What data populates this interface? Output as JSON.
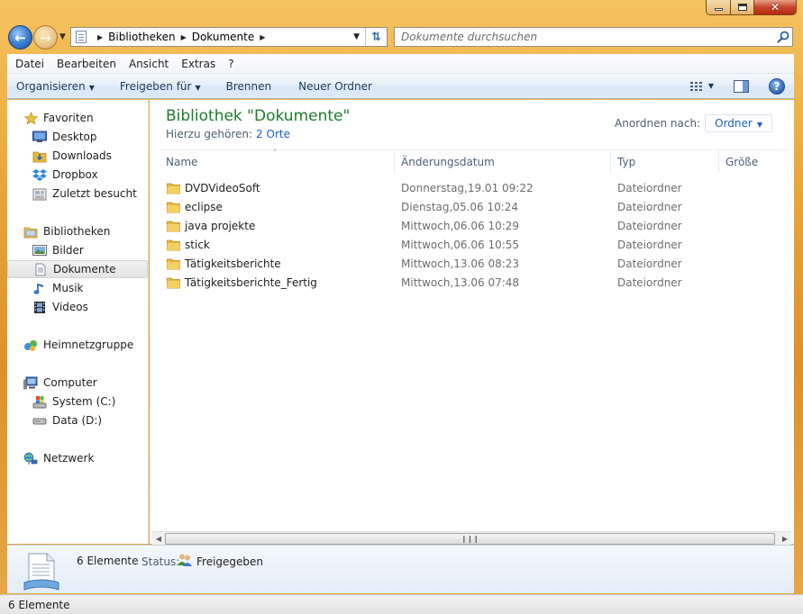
{
  "window": {
    "minimize_label": "",
    "close_glyph": "✕"
  },
  "address_bar": {
    "crumbs": [
      "Bibliotheken",
      "Dokumente"
    ],
    "search_placeholder": "Dokumente durchsuchen"
  },
  "menu": {
    "items": [
      "Datei",
      "Bearbeiten",
      "Ansicht",
      "Extras",
      "?"
    ]
  },
  "commands": {
    "organize": "Organisieren",
    "share": "Freigeben für",
    "burn": "Brennen",
    "new_folder": "Neuer Ordner"
  },
  "nav": {
    "favorites": {
      "label": "Favoriten",
      "items": [
        "Desktop",
        "Downloads",
        "Dropbox",
        "Zuletzt besucht"
      ]
    },
    "libraries": {
      "label": "Bibliotheken",
      "items": [
        "Bilder",
        "Dokumente",
        "Musik",
        "Videos"
      ],
      "selected": "Dokumente"
    },
    "homegroup": {
      "label": "Heimnetzgruppe"
    },
    "computer": {
      "label": "Computer",
      "items": [
        "System (C:)",
        "Data (D:)"
      ]
    },
    "network": {
      "label": "Netzwerk"
    }
  },
  "library": {
    "title": "Bibliothek \"Dokumente\"",
    "includes_label": "Hierzu gehören:",
    "includes_link": "2 Orte",
    "arrange_label": "Anordnen nach:",
    "arrange_value": "Ordner"
  },
  "columns": [
    "Name",
    "Änderungsdatum",
    "Typ",
    "Größe"
  ],
  "files": [
    {
      "name": "DVDVideoSoft",
      "date": "Donnerstag,19.01 09:22",
      "type": "Dateiordner"
    },
    {
      "name": "eclipse",
      "date": "Dienstag,05.06 10:24",
      "type": "Dateiordner"
    },
    {
      "name": "java projekte",
      "date": "Mittwoch,06.06 10:29",
      "type": "Dateiordner"
    },
    {
      "name": "stick",
      "date": "Mittwoch,06.06 10:55",
      "type": "Dateiordner"
    },
    {
      "name": "Tätigkeitsberichte",
      "date": "Mittwoch,13.06 08:23",
      "type": "Dateiordner"
    },
    {
      "name": "Tätigkeitsberichte_Fertig",
      "date": "Mittwoch,13.06 07:48",
      "type": "Dateiordner"
    }
  ],
  "details": {
    "count": "6 Elemente",
    "status_label": "Status:",
    "status_value": "Freigegeben"
  },
  "statusbar": {
    "text": "6 Elemente"
  },
  "colors": {
    "title_green": "#1e7b2b",
    "link_blue": "#1e5fc4",
    "frame_orange": "#e9a63a",
    "folder_yellow": "#e8b83c"
  }
}
